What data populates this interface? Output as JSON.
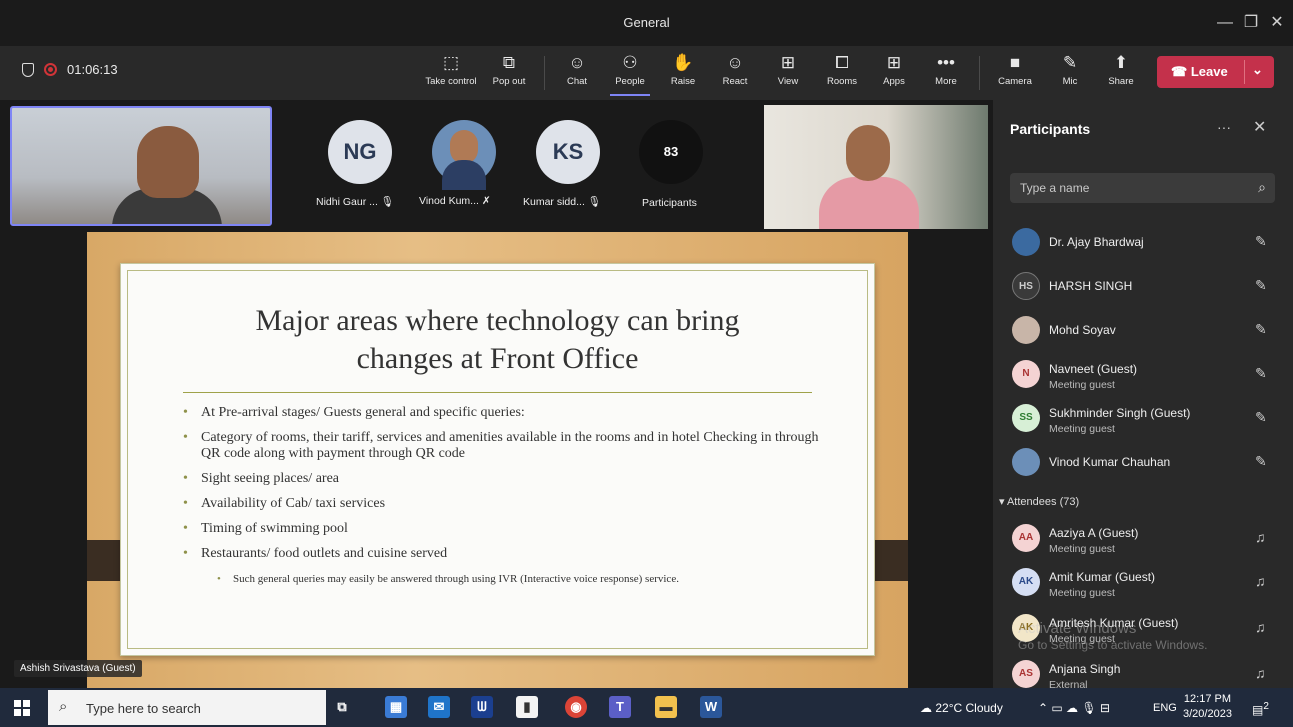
{
  "window": {
    "title": "General",
    "minimize": "—",
    "maximize": "❐",
    "close": "✕"
  },
  "toolbar": {
    "timer": "01:06:13",
    "buttons": [
      {
        "label": "Take control",
        "icon": "⬚"
      },
      {
        "label": "Pop out",
        "icon": "⧉"
      },
      {
        "label": "Chat",
        "icon": "☺"
      },
      {
        "label": "People",
        "icon": "⚇"
      },
      {
        "label": "Raise",
        "icon": "✋"
      },
      {
        "label": "React",
        "icon": "☺"
      },
      {
        "label": "View",
        "icon": "⊞"
      },
      {
        "label": "Rooms",
        "icon": "⧠"
      },
      {
        "label": "Apps",
        "icon": "⊞"
      },
      {
        "label": "More",
        "icon": "•••"
      },
      {
        "label": "Camera",
        "icon": "■"
      },
      {
        "label": "Mic",
        "icon": "✎"
      },
      {
        "label": "Share",
        "icon": "⬆"
      }
    ],
    "leave_label": "Leave"
  },
  "stage": {
    "avatars": [
      {
        "initials": "NG",
        "name": "Nidhi Gaur ...",
        "mic": "🎙"
      },
      {
        "initials": "",
        "name": "Vinod Kum...",
        "mic": "✗"
      },
      {
        "initials": "KS",
        "name": "Kumar sidd...",
        "mic": "🎙"
      }
    ],
    "participants_count": "83",
    "participants_label": "Participants",
    "presenter_name": "Ashish Srivastava (Guest)"
  },
  "slide": {
    "title_line1": "Major areas where technology can bring",
    "title_line2": "changes at Front Office",
    "bullets": [
      "At Pre-arrival stages/ Guests general and specific queries:",
      "Category of rooms, their tariff, services and amenities available in the rooms and in hotel Checking in through QR code along with payment through QR code",
      "Sight seeing places/ area",
      "Availability of Cab/ taxi services",
      "Timing of swimming pool",
      "Restaurants/ food outlets and cuisine served"
    ],
    "sub_bullet": "Such general queries may easily be answered through using IVR (Interactive voice response) service."
  },
  "panel": {
    "title": "Participants",
    "more": "···",
    "close": "✕",
    "search_placeholder": "Type a name",
    "presenters": [
      {
        "initials": "",
        "name": "Dr. Ajay Bhardwaj",
        "sub": ""
      },
      {
        "initials": "HS",
        "name": "HARSH SINGH",
        "sub": ""
      },
      {
        "initials": "",
        "name": "Mohd Soyav",
        "sub": ""
      },
      {
        "initials": "N",
        "name": "Navneet (Guest)",
        "sub": "Meeting guest"
      },
      {
        "initials": "SS",
        "name": "Sukhminder Singh (Guest)",
        "sub": "Meeting guest"
      },
      {
        "initials": "",
        "name": "Vinod Kumar Chauhan",
        "sub": ""
      }
    ],
    "attendees_header": "▾ Attendees (73)",
    "attendees": [
      {
        "initials": "AA",
        "name": "Aaziya A (Guest)",
        "sub": "Meeting guest"
      },
      {
        "initials": "AK",
        "name": "Amit Kumar (Guest)",
        "sub": "Meeting guest"
      },
      {
        "initials": "AK",
        "name": "Amritesh Kumar (Guest)",
        "sub": "Meeting guest"
      },
      {
        "initials": "AS",
        "name": "Anjana Singh",
        "sub": "External"
      }
    ],
    "mic_muted_icon": "✎",
    "mic_icon": "♫"
  },
  "watermark": {
    "line1": "Activate Windows",
    "line2": "Go to Settings to activate Windows."
  },
  "taskbar": {
    "search_placeholder": "Type here to search",
    "weather": "22°C  Cloudy",
    "lang": "ENG",
    "time": "12:17 PM",
    "date": "3/20/2023",
    "notif": "2"
  },
  "colors": {
    "accent": "#7f85f5",
    "leave": "#c4314b",
    "panel": "#292929"
  }
}
